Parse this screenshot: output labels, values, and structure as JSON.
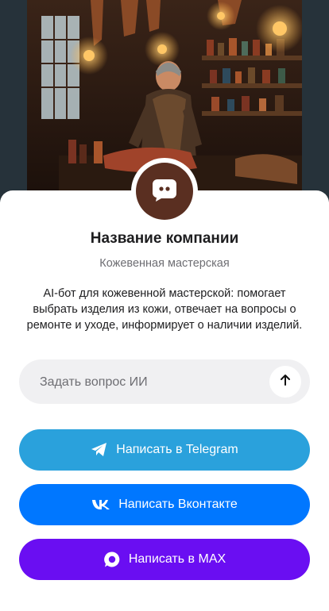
{
  "company": {
    "name": "Название компании",
    "subtitle": "Кожевенная мастерская",
    "description": "AI-бот для кожевенной мастерской: помогает выбрать изделия из кожи, отвечает на вопросы о ремонте и уходе, информирует о наличии изделий."
  },
  "ask": {
    "placeholder": "Задать вопрос ИИ",
    "value": ""
  },
  "buttons": {
    "telegram": {
      "label": "Написать в Telegram",
      "color": "#2aa1dc"
    },
    "vk": {
      "label": "Написать Вконтакте",
      "color": "#0077ff"
    },
    "max": {
      "label": "Написать в MAX",
      "color": "#6a0ef2"
    }
  },
  "icons": {
    "avatar": "chat-bubble-icon",
    "send": "arrow-up-icon",
    "telegram": "telegram-icon",
    "vk": "vk-icon",
    "max": "max-icon"
  },
  "colors": {
    "avatar_bg": "#5a2f21",
    "page_bg": "#26323a"
  }
}
